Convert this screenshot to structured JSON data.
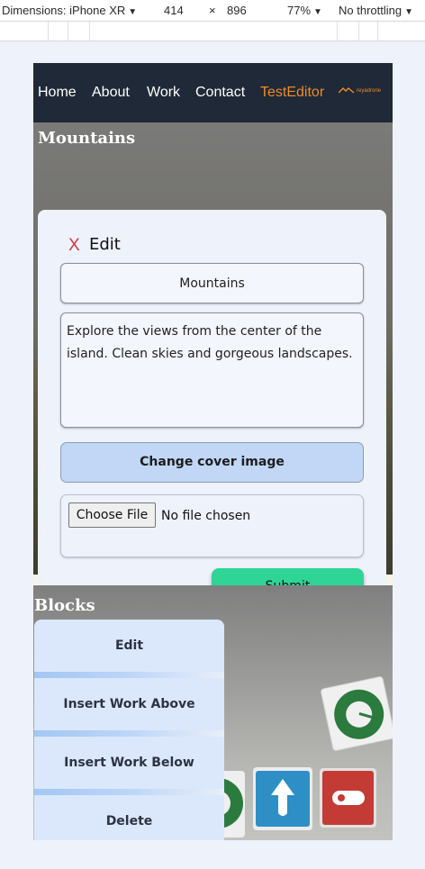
{
  "devtools": {
    "dimensions_label": "Dimensions: iPhone XR",
    "width_value": "414",
    "times_symbol": "×",
    "height_value": "896",
    "zoom": "77%",
    "throttling": "No throttling",
    "caret_icon": "triangle-down"
  },
  "nav": {
    "links": [
      "Home",
      "About",
      "Work",
      "Contact"
    ],
    "active_link": "TestEditor",
    "logo_text": "reyadrone"
  },
  "hero": {
    "title": "Mountains"
  },
  "editor": {
    "close_label": "X",
    "heading": "Edit",
    "title_value": "Mountains",
    "description_value": "Explore the views from the center of the island. Clean skies and gorgeous landscapes.",
    "change_cover_label": "Change cover image",
    "choose_file_label": "Choose File",
    "no_file_label": "No file chosen",
    "submit_label": "Submit"
  },
  "blocks": {
    "title": "Blocks",
    "menu_items": [
      "Edit",
      "Insert Work Above",
      "Insert Work Below",
      "Delete"
    ]
  },
  "colors": {
    "nav_bg": "#1f2937",
    "accent_orange": "#f08a24",
    "close_red": "#d9363e",
    "submit_green": "#2fd497",
    "cover_button_blue": "#c1d7f5",
    "menu_blue": "#dbe8fc"
  }
}
